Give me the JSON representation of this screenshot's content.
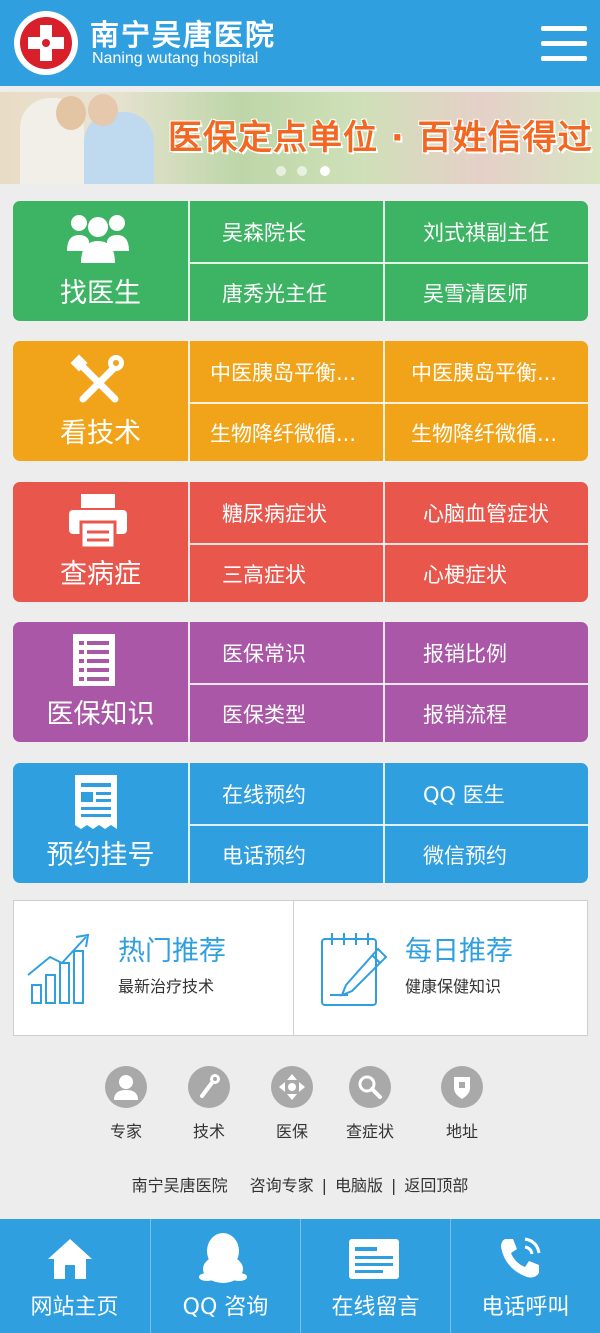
{
  "header": {
    "title_cn": "南宁吴唐医院",
    "title_en": "Naning wutang hospital",
    "menu_icon": "hamburger-menu-icon",
    "logo_icon": "red-cross-logo-icon"
  },
  "banner": {
    "slogan": "医保定点单位 · 百姓信得过",
    "slide_count": 3
  },
  "sections": {
    "doctors": {
      "label": "找医生",
      "icon": "people-icon",
      "color": "#3db364",
      "links": [
        "吴森院长",
        "刘式祺副主任",
        "唐秀光主任",
        "吴雪清医师"
      ]
    },
    "techniques": {
      "label": "看技术",
      "icon": "tools-icon",
      "color": "#f1a41a",
      "links": [
        "中医胰岛平衡...",
        "中医胰岛平衡...",
        "生物降纤微循...",
        "生物降纤微循..."
      ]
    },
    "symptoms": {
      "label": "查病症",
      "icon": "printer-icon",
      "color": "#e8564c",
      "links": [
        "糖尿病症状",
        "心脑血管症状",
        "三高症状",
        "心梗症状"
      ]
    },
    "insurance": {
      "label": "医保知识",
      "icon": "document-list-icon",
      "color": "#a957a6",
      "links": [
        "医保常识",
        "报销比例",
        "医保类型",
        "报销流程"
      ]
    },
    "appointment": {
      "label": "预约挂号",
      "icon": "receipt-icon",
      "color": "#2f9fe0",
      "links": [
        "在线预约",
        "QQ 医生",
        "电话预约",
        "微信预约"
      ]
    }
  },
  "recommend": {
    "hot": {
      "title": "热门推荐",
      "subtitle": "最新治疗技术",
      "icon": "bar-chart-icon"
    },
    "daily": {
      "title": "每日推荐",
      "subtitle": "健康保健知识",
      "icon": "notepad-pencil-icon"
    }
  },
  "quick_icons": [
    {
      "label": "专家",
      "icon": "person-icon"
    },
    {
      "label": "技术",
      "icon": "wrench-icon"
    },
    {
      "label": "医保",
      "icon": "arrows-icon"
    },
    {
      "label": "查症状",
      "icon": "magnifier-icon"
    },
    {
      "label": "地址",
      "icon": "location-icon"
    }
  ],
  "footer_links": {
    "hospital": "南宁吴唐医院",
    "consult": "咨询专家",
    "desktop": "电脑版",
    "top": "返回顶部",
    "separator": "|"
  },
  "bottom_nav": [
    {
      "label": "网站主页",
      "icon": "home-icon"
    },
    {
      "label": "QQ 咨询",
      "icon": "qq-penguin-icon"
    },
    {
      "label": "在线留言",
      "icon": "message-board-icon"
    },
    {
      "label": "电话呼叫",
      "icon": "phone-icon"
    }
  ]
}
